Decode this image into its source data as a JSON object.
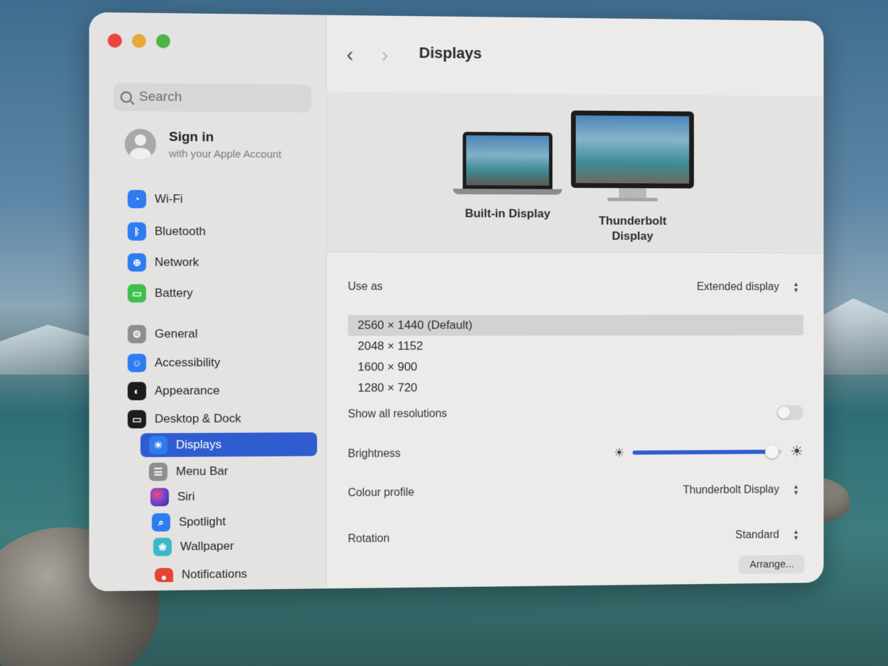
{
  "window": {
    "title": "Displays"
  },
  "search": {
    "placeholder": "Search"
  },
  "account": {
    "title": "Sign in",
    "subtitle": "with your Apple Account"
  },
  "sidebar": {
    "items": [
      {
        "label": "Wi-Fi",
        "icon": "wifi-icon"
      },
      {
        "label": "Bluetooth",
        "icon": "bluetooth-icon"
      },
      {
        "label": "Network",
        "icon": "globe-icon"
      },
      {
        "label": "Battery",
        "icon": "battery-icon"
      },
      {
        "label": "General",
        "icon": "gear-icon"
      },
      {
        "label": "Accessibility",
        "icon": "accessibility-icon"
      },
      {
        "label": "Appearance",
        "icon": "appearance-icon"
      },
      {
        "label": "Desktop & Dock",
        "icon": "dock-icon"
      },
      {
        "label": "Displays",
        "icon": "sun-icon"
      },
      {
        "label": "Menu Bar",
        "icon": "menubar-icon"
      },
      {
        "label": "Siri",
        "icon": "siri-icon"
      },
      {
        "label": "Spotlight",
        "icon": "search-icon"
      },
      {
        "label": "Wallpaper",
        "icon": "flower-icon"
      },
      {
        "label": "Notifications",
        "icon": "bell-icon"
      }
    ],
    "selected": "Displays"
  },
  "displays": {
    "builtin_label": "Built-in Display",
    "external_label": "Thunderbolt Display"
  },
  "settings": {
    "use_as_label": "Use as",
    "use_as_value": "Extended display",
    "resolutions": [
      "2560 × 1440 (Default)",
      "2048 × 1152",
      "1600 × 900",
      "1280 × 720"
    ],
    "selected_resolution": "2560 × 1440 (Default)",
    "show_all_label": "Show all resolutions",
    "brightness_label": "Brightness",
    "brightness_value": 0.93,
    "colour_profile_label": "Colour profile",
    "colour_profile_value": "Thunderbolt Display",
    "rotation_label": "Rotation",
    "rotation_value": "Standard",
    "arrange_label": "Arrange..."
  },
  "colors": {
    "accent": "#2f5dcf"
  }
}
